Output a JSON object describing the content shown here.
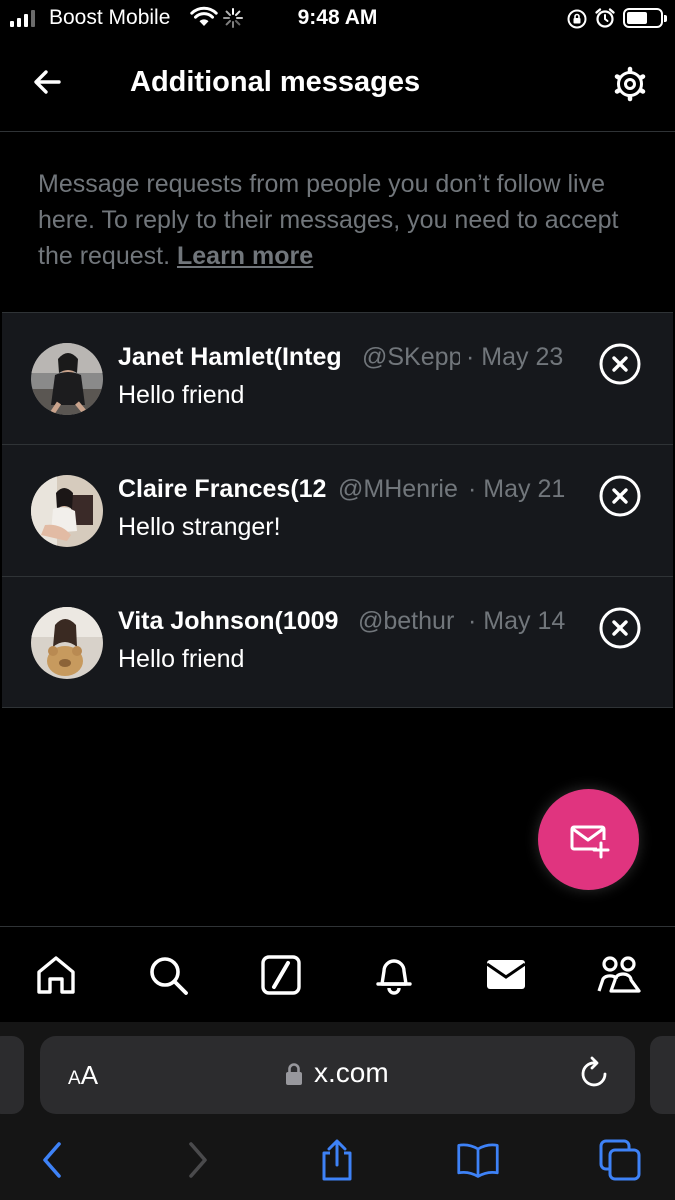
{
  "status_bar": {
    "carrier": "Boost Mobile",
    "time": "9:48 AM"
  },
  "header": {
    "title": "Additional messages",
    "back_icon": "arrow-left-icon",
    "settings_icon": "gear-icon"
  },
  "info": {
    "text": "Message requests from people you don’t follow live here. To reply to their messages, you need to accept the request. ",
    "link": "Learn more"
  },
  "messages": [
    {
      "name": "Janet Hamlet(Integ",
      "handle": "@SKepp",
      "date": "· May 23",
      "text": "Hello friend"
    },
    {
      "name": "Claire Frances(12",
      "handle": "@MHenrie",
      "date": "· May 21",
      "text": "Hello stranger!"
    },
    {
      "name": "Vita Johnson(1009",
      "handle": "@bethur",
      "date": "· May 14",
      "text": "Hello friend"
    }
  ],
  "colors": {
    "accent_fab": "#e0347f",
    "row_bg": "#16181c",
    "muted": "#71767b",
    "link_blue": "#3e82f7"
  },
  "bottom_nav": [
    "home-icon",
    "search-icon",
    "grok-icon",
    "notifications-icon",
    "messages-icon",
    "communities-icon"
  ],
  "safari": {
    "aa_label_small": "A",
    "aa_label_large": "A",
    "url": "x.com"
  }
}
